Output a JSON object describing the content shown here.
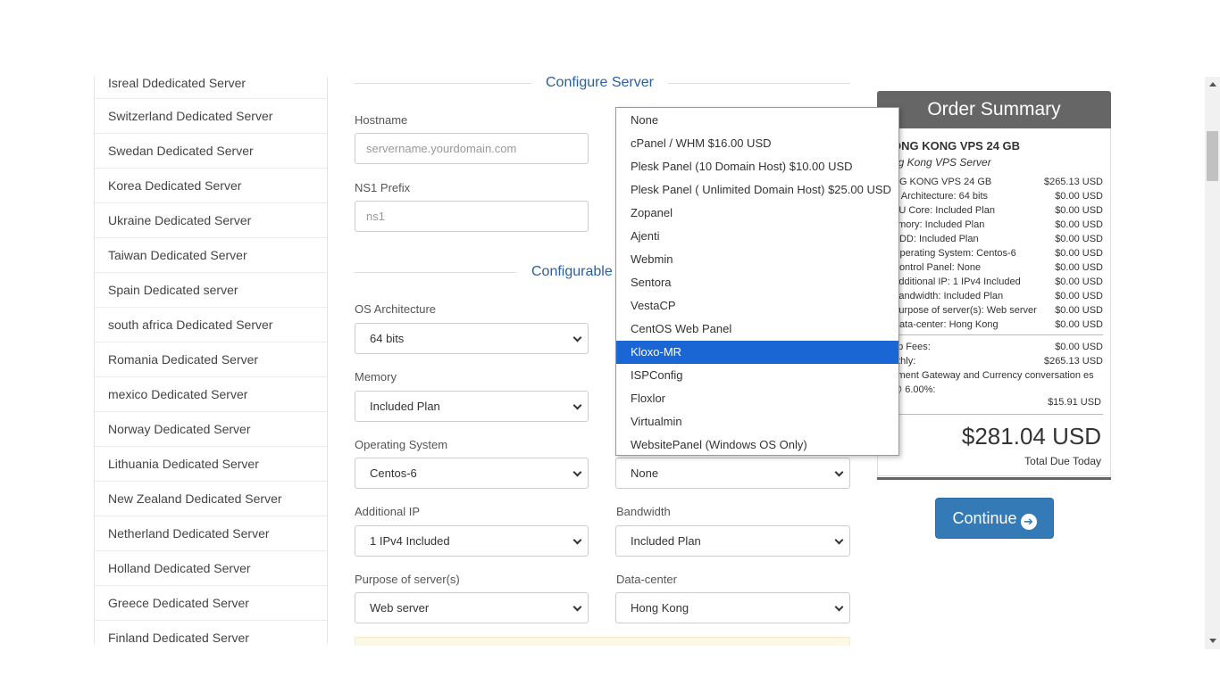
{
  "sidebar": {
    "items": [
      "Isreal Ddedicated Server",
      "Switzerland Dedicated Server",
      "Swedan Dedicated Server",
      "Korea Dedicated Server",
      "Ukraine Dedicated Server",
      "Taiwan Dedicated Server",
      "Spain Dedicated server",
      "south africa Dedicated Server",
      "Romania Dedicated Server",
      "mexico Dedicated Server",
      "Norway Dedicated Server",
      "Lithuania Dedicated Server",
      "New Zealand Dedicated Server",
      "Netherland Dedicated Server",
      "Holland Dedicated Server",
      "Greece Dedicated Server",
      "Finland Dedicated Server"
    ]
  },
  "configure": {
    "title": "Configure Server",
    "hostname_label": "Hostname",
    "hostname_placeholder": "servername.yourdomain.com",
    "ns1_label": "NS1 Prefix",
    "ns1_placeholder": "ns1"
  },
  "configurable": {
    "title": "Configurable",
    "os_arch_label": "OS Architecture",
    "os_arch_value": "64 bits",
    "memory_label": "Memory",
    "memory_value": "Included Plan",
    "os_label": "Operating System",
    "os_value": "Centos-6",
    "control_panel_value": "None",
    "additional_ip_label": "Additional IP",
    "additional_ip_value": "1 IPv4 Included",
    "bandwidth_label": "Bandwidth",
    "bandwidth_value": "Included Plan",
    "purpose_label": "Purpose of server(s)",
    "purpose_value": "Web server",
    "datacenter_label": "Data-center",
    "datacenter_value": "Hong Kong"
  },
  "dropdown": {
    "options": [
      "None",
      "cPanel / WHM $16.00 USD",
      "Plesk Panel (10 Domain Host) $10.00 USD",
      "Plesk Panel ( Unlimited Domain Host) $25.00 USD",
      "Zopanel",
      "Ajenti",
      "Webmin",
      "Sentora",
      "VestaCP",
      "CentOS Web Panel",
      "Kloxo-MR",
      "ISPConfig",
      "Floxlor",
      "Virtualmin",
      "WebsitePanel (Windows OS Only)"
    ],
    "selected_index": 10
  },
  "summary": {
    "title": "Order Summary",
    "product_name": "ONG KONG VPS 24 GB",
    "product_group": "ng Kong VPS Server",
    "items": [
      {
        "label": "NG KONG VPS 24 GB",
        "amount": "$265.13 USD"
      },
      {
        "label": "S Architecture: 64 bits",
        "amount": "$0.00 USD"
      },
      {
        "label": "PU Core: Included Plan",
        "amount": "$0.00 USD"
      },
      {
        "label": "emory: Included Plan",
        "amount": "$0.00 USD"
      },
      {
        "label": "HDD: Included Plan",
        "amount": "$0.00 USD"
      },
      {
        "label": "Operating System: Centos-6",
        "amount": "$0.00 USD"
      },
      {
        "label": "Control Panel: None",
        "amount": "$0.00 USD"
      },
      {
        "label": "Additional IP: 1 IPv4 Included",
        "amount": "$0.00 USD"
      },
      {
        "label": "Bandwidth: Included Plan",
        "amount": "$0.00 USD"
      },
      {
        "label": "Purpose of server(s): Web server",
        "amount": "$0.00 USD"
      },
      {
        "label": "Data-center: Hong Kong",
        "amount": "$0.00 USD"
      }
    ],
    "setup_label": "up Fees:",
    "setup_amount": "$0.00 USD",
    "monthly_label": "nthly:",
    "monthly_amount": "$265.13 USD",
    "tax_text": "yment Gateway and Currency conversation es @ 6.00%:",
    "tax_amount": "$15.91 USD",
    "total": "$281.04 USD",
    "total_label": "Total Due Today"
  },
  "continue_label": "Continue",
  "colors": {
    "accent": "#337ab7",
    "heading": "#2c5f9b",
    "selected": "#1a66d4",
    "summary_header": "#666666"
  }
}
